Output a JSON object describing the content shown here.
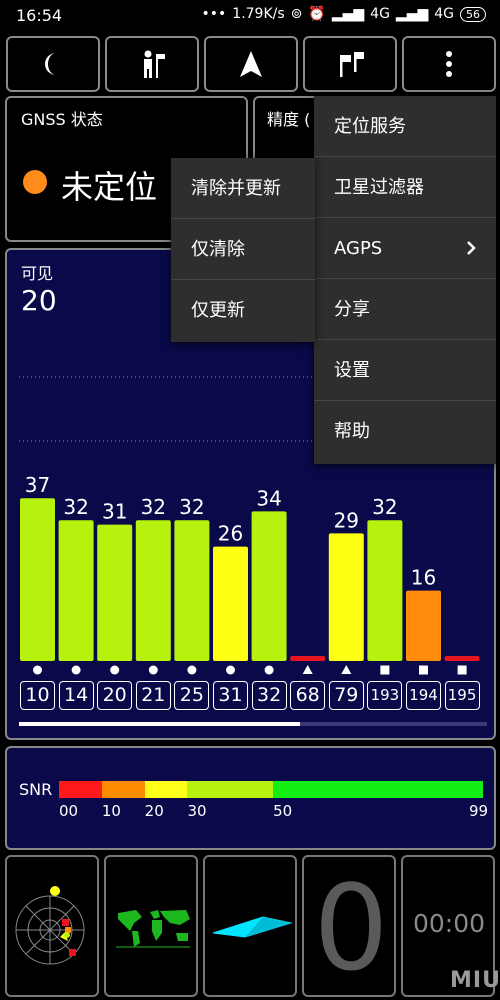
{
  "status_bar": {
    "time": "16:54",
    "network_speed": "1.79K/s",
    "signal1": "4G",
    "signal2": "4G",
    "battery": "56"
  },
  "toolbar": {
    "buttons": [
      {
        "icon": "moon-icon"
      },
      {
        "icon": "people-icon"
      },
      {
        "icon": "navigation-arrow-icon"
      },
      {
        "icon": "flags-icon"
      },
      {
        "icon": "more-vert-icon"
      }
    ]
  },
  "gnss": {
    "title": "GNSS 状态",
    "status": "未定位",
    "status_color": "#ff8c1a"
  },
  "accuracy": {
    "title": "精度 ("
  },
  "sky": {
    "visible_label": "可见",
    "visible_count": "20"
  },
  "chart_data": {
    "type": "bar",
    "categories": [
      "10",
      "14",
      "20",
      "21",
      "25",
      "31",
      "32",
      "68",
      "79",
      "193",
      "194",
      "195"
    ],
    "values": [
      37,
      32,
      31,
      32,
      32,
      26,
      34,
      0,
      29,
      32,
      16,
      0
    ],
    "value_labels": [
      "37",
      "32",
      "31",
      "32",
      "32",
      "26",
      "34",
      "",
      "29",
      "32",
      "16",
      ""
    ],
    "markers": [
      "circle",
      "circle",
      "circle",
      "circle",
      "circle",
      "circle",
      "circle",
      "triangle",
      "triangle",
      "square",
      "square",
      "square"
    ],
    "colors": [
      "#b6f20e",
      "#b6f20e",
      "#b6f20e",
      "#b6f20e",
      "#b6f20e",
      "#ffff14",
      "#b6f20e",
      "#e8141e",
      "#ffff14",
      "#b6f20e",
      "#ff8c0a",
      "#e8141e"
    ],
    "ylim": [
      0,
      99
    ]
  },
  "snr": {
    "label": "SNR",
    "ticks": [
      "00",
      "10",
      "20",
      "30",
      "50",
      "99"
    ],
    "scale_colors": [
      "#ff1a1a",
      "#ff8c00",
      "#ffff1a",
      "#b6f20e",
      "#14ee14"
    ]
  },
  "tiles": {
    "big_digit": "0",
    "timer": "00:00"
  },
  "menu_main": {
    "items": [
      "定位服务",
      "卫星过滤器",
      "AGPS",
      "分享",
      "设置",
      "帮助"
    ]
  },
  "menu_sub": {
    "items": [
      "清除并更新",
      "仅清除",
      "仅更新"
    ]
  },
  "watermark": "MIUI"
}
